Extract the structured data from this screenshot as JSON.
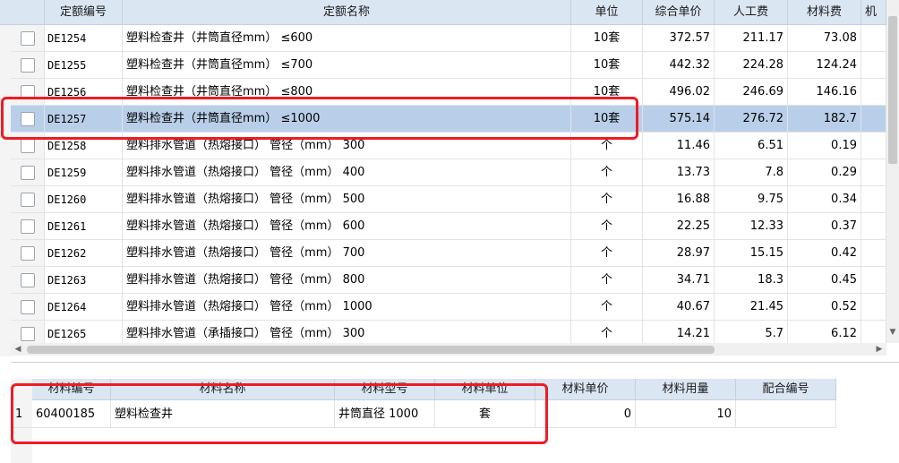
{
  "quota_table": {
    "columns": {
      "code": "定额编号",
      "name": "定额名称",
      "unit": "单位",
      "unit_price": "综合单价",
      "labor": "人工费",
      "material": "材料费",
      "more": "机"
    },
    "rows": [
      {
        "code": "DE1254",
        "name": "塑料检查井（井筒直径mm） ≤600",
        "unit": "10套",
        "unit_price": "372.57",
        "labor": "211.17",
        "material": "73.08"
      },
      {
        "code": "DE1255",
        "name": "塑料检查井（井筒直径mm） ≤700",
        "unit": "10套",
        "unit_price": "442.32",
        "labor": "224.28",
        "material": "124.24"
      },
      {
        "code": "DE1256",
        "name": "塑料检查井（井筒直径mm） ≤800",
        "unit": "10套",
        "unit_price": "496.02",
        "labor": "246.69",
        "material": "146.16"
      },
      {
        "code": "DE1257",
        "name": "塑料检查井（井筒直径mm） ≤1000",
        "unit": "10套",
        "unit_price": "575.14",
        "labor": "276.72",
        "material": "182.7"
      },
      {
        "code": "DE1258",
        "name": "塑料排水管道（热熔接口） 管径（mm） 300",
        "unit": "个",
        "unit_price": "11.46",
        "labor": "6.51",
        "material": "0.19"
      },
      {
        "code": "DE1259",
        "name": "塑料排水管道（热熔接口） 管径（mm） 400",
        "unit": "个",
        "unit_price": "13.73",
        "labor": "7.8",
        "material": "0.29"
      },
      {
        "code": "DE1260",
        "name": "塑料排水管道（热熔接口） 管径（mm） 500",
        "unit": "个",
        "unit_price": "16.88",
        "labor": "9.75",
        "material": "0.34"
      },
      {
        "code": "DE1261",
        "name": "塑料排水管道（热熔接口） 管径（mm） 600",
        "unit": "个",
        "unit_price": "22.25",
        "labor": "12.33",
        "material": "0.37"
      },
      {
        "code": "DE1262",
        "name": "塑料排水管道（热熔接口） 管径（mm） 700",
        "unit": "个",
        "unit_price": "28.97",
        "labor": "15.15",
        "material": "0.42"
      },
      {
        "code": "DE1263",
        "name": "塑料排水管道（热熔接口） 管径（mm） 800",
        "unit": "个",
        "unit_price": "34.71",
        "labor": "18.3",
        "material": "0.45"
      },
      {
        "code": "DE1264",
        "name": "塑料排水管道（热熔接口） 管径（mm） 1000",
        "unit": "个",
        "unit_price": "40.67",
        "labor": "21.45",
        "material": "0.52"
      },
      {
        "code": "DE1265",
        "name": "塑料排水管道（承插接口） 管径（mm） 300",
        "unit": "个",
        "unit_price": "14.21",
        "labor": "5.7",
        "material": "6.12"
      }
    ],
    "selected_row": 3
  },
  "material_table": {
    "columns": {
      "code": "材料编号",
      "name": "材料名称",
      "model": "材料型号",
      "unit": "材料单位",
      "price": "材料单价",
      "quantity": "材料用量",
      "match_code": "配合编号"
    },
    "rows": [
      {
        "index": "1",
        "code": "60400185",
        "name": "塑料检查井",
        "model": "井筒直径 1000",
        "unit": "套",
        "price": "0",
        "quantity": "10",
        "match_code": ""
      }
    ]
  },
  "colors": {
    "header_bg": "#dbe6f3",
    "selected_row_bg": "#b9cfe9",
    "annotation_red": "#ee1c24"
  }
}
